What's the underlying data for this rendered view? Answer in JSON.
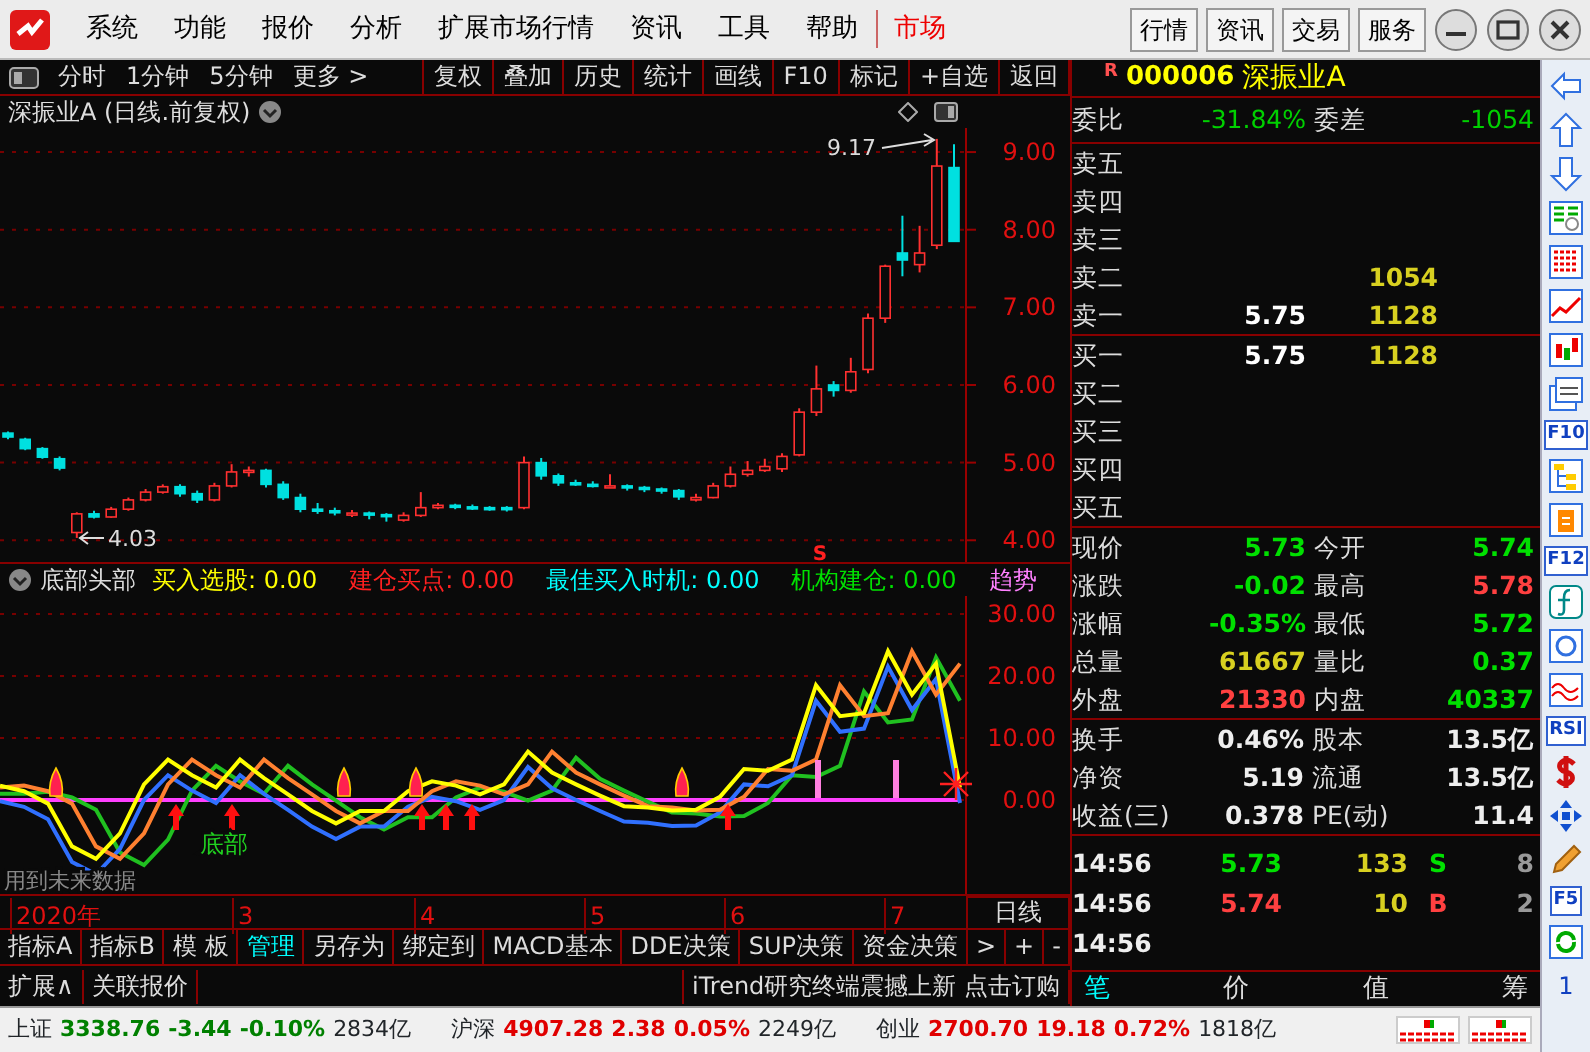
{
  "menu_bar": {
    "items": [
      {
        "label": "系统",
        "selected": false
      },
      {
        "label": "功能",
        "selected": false
      },
      {
        "label": "报价",
        "selected": false
      },
      {
        "label": "分析",
        "selected": false
      },
      {
        "label": "扩展市场行情",
        "selected": false
      },
      {
        "label": "资讯",
        "selected": false
      },
      {
        "label": "工具",
        "selected": false
      },
      {
        "label": "帮助",
        "selected": false
      },
      {
        "label": "市场",
        "selected": true
      }
    ],
    "buttons": [
      "行情",
      "资讯",
      "交易",
      "服务"
    ]
  },
  "toolbar": {
    "period_tabs": [
      "分时",
      "1分钟",
      "5分钟",
      "更多 >"
    ],
    "tools": [
      "复权",
      "叠加",
      "历史",
      "统计",
      "画线",
      "F10",
      "标记",
      "+自选",
      "返回"
    ]
  },
  "price_chart": {
    "title": "深振业A (日线.前复权)",
    "high_label": "9.17",
    "low_label": "4.03",
    "signal": "S",
    "chart_data": {
      "type": "candlestick",
      "grid": true,
      "ylim": [
        3.72,
        9.31
      ],
      "yticks": [
        {
          "value": 9,
          "label": "9.00"
        },
        {
          "value": 8,
          "label": "8.00"
        },
        {
          "value": 7,
          "label": "7.00"
        },
        {
          "value": 6,
          "label": "6.00"
        },
        {
          "value": 5,
          "label": "5.00"
        },
        {
          "value": 4,
          "label": "4.00"
        }
      ],
      "ohlc": [
        [
          5.38,
          5.4,
          5.3,
          5.33
        ],
        [
          5.3,
          5.32,
          5.16,
          5.18
        ],
        [
          5.18,
          5.2,
          5.05,
          5.07
        ],
        [
          5.05,
          5.08,
          4.9,
          4.93
        ],
        [
          4.1,
          4.36,
          4.03,
          4.34
        ],
        [
          4.34,
          4.38,
          4.28,
          4.3
        ],
        [
          4.3,
          4.43,
          4.29,
          4.4
        ],
        [
          4.4,
          4.55,
          4.38,
          4.52
        ],
        [
          4.52,
          4.66,
          4.5,
          4.62
        ],
        [
          4.62,
          4.72,
          4.6,
          4.69
        ],
        [
          4.69,
          4.72,
          4.56,
          4.6
        ],
        [
          4.6,
          4.64,
          4.48,
          4.52
        ],
        [
          4.52,
          4.74,
          4.5,
          4.7
        ],
        [
          4.7,
          4.98,
          4.68,
          4.88
        ],
        [
          4.88,
          4.95,
          4.82,
          4.9
        ],
        [
          4.9,
          4.92,
          4.68,
          4.72
        ],
        [
          4.72,
          4.76,
          4.52,
          4.55
        ],
        [
          4.55,
          4.6,
          4.36,
          4.4
        ],
        [
          4.4,
          4.48,
          4.34,
          4.38
        ],
        [
          4.38,
          4.42,
          4.32,
          4.36
        ],
        [
          4.33,
          4.39,
          4.3,
          4.35
        ],
        [
          4.35,
          4.37,
          4.27,
          4.33
        ],
        [
          4.33,
          4.35,
          4.24,
          4.31
        ],
        [
          4.26,
          4.36,
          4.24,
          4.32
        ],
        [
          4.32,
          4.62,
          4.3,
          4.42
        ],
        [
          4.42,
          4.48,
          4.4,
          4.45
        ],
        [
          4.45,
          4.47,
          4.4,
          4.43
        ],
        [
          4.43,
          4.46,
          4.39,
          4.42
        ],
        [
          4.42,
          4.44,
          4.38,
          4.41
        ],
        [
          4.42,
          4.44,
          4.37,
          4.4
        ],
        [
          4.42,
          5.08,
          4.4,
          5.0
        ],
        [
          5.0,
          5.06,
          4.78,
          4.83
        ],
        [
          4.83,
          4.86,
          4.7,
          4.74
        ],
        [
          4.74,
          4.78,
          4.7,
          4.72
        ],
        [
          4.72,
          4.76,
          4.68,
          4.71
        ],
        [
          4.7,
          4.85,
          4.68,
          4.7
        ],
        [
          4.7,
          4.72,
          4.64,
          4.68
        ],
        [
          4.68,
          4.7,
          4.62,
          4.66
        ],
        [
          4.66,
          4.68,
          4.6,
          4.64
        ],
        [
          4.64,
          4.66,
          4.52,
          4.56
        ],
        [
          4.52,
          4.6,
          4.5,
          4.55
        ],
        [
          4.55,
          4.74,
          4.54,
          4.7
        ],
        [
          4.7,
          4.95,
          4.68,
          4.85
        ],
        [
          4.85,
          5.02,
          4.82,
          4.9
        ],
        [
          4.9,
          5.05,
          4.88,
          4.95
        ],
        [
          4.92,
          5.12,
          4.88,
          5.08
        ],
        [
          5.1,
          5.7,
          5.08,
          5.65
        ],
        [
          5.65,
          6.25,
          5.6,
          5.95
        ],
        [
          6.0,
          6.05,
          5.85,
          5.93
        ],
        [
          5.93,
          6.35,
          5.9,
          6.17
        ],
        [
          6.2,
          6.92,
          6.15,
          6.86
        ],
        [
          6.86,
          7.55,
          6.8,
          7.53
        ],
        [
          7.7,
          8.18,
          7.4,
          7.61
        ],
        [
          7.55,
          8.05,
          7.45,
          7.7
        ],
        [
          7.8,
          9.17,
          7.75,
          8.82
        ],
        [
          8.8,
          9.1,
          7.85,
          7.85
        ]
      ]
    }
  },
  "indicator": {
    "name": "底部头部",
    "values": [
      {
        "label": "买入选股: 0.00",
        "color": "#ffff00"
      },
      {
        "label": "建仓买点: 0.00",
        "color": "#ff2020"
      },
      {
        "label": "最佳买入时机: 0.00",
        "color": "#00ffff"
      },
      {
        "label": "机构建仓: 0.00",
        "color": "#00e000"
      },
      {
        "label": "趋势",
        "color": "#ff80ff"
      }
    ],
    "chart_data": {
      "type": "line",
      "grid": true,
      "ylim": [
        -15.5,
        32.9
      ],
      "yticks": [
        {
          "value": 30,
          "label": "30.00"
        },
        {
          "value": 20,
          "label": "20.00"
        },
        {
          "value": 10,
          "label": "10.00"
        },
        {
          "value": 0,
          "label": "0.00"
        }
      ],
      "series": [
        {
          "color": "#ff40ff",
          "values": [
            0,
            0,
            0,
            0,
            0,
            0,
            0,
            0,
            0,
            0,
            0,
            0,
            0,
            0,
            0,
            0,
            0,
            0,
            0,
            0,
            0,
            0,
            0,
            0,
            0,
            0,
            0,
            0,
            0,
            0,
            0,
            0,
            0,
            0,
            0,
            0,
            0,
            0,
            0,
            0,
            0
          ]
        },
        {
          "color": "#20c020",
          "values": [
            1,
            1,
            1.3,
            0.4,
            -1.6,
            -8.5,
            -10.5,
            -6.4,
            1.5,
            5.5,
            3,
            1,
            5.5,
            2.5,
            -0.1,
            -2.8,
            -4.8,
            -2.8,
            -2.8,
            0.4,
            2,
            1.3,
            -0.1,
            1.5,
            6.8,
            3.4,
            1.5,
            -0.3,
            -2,
            -2.2,
            -2.7,
            -2.6,
            -0.5,
            4,
            3.7,
            5.5,
            17.5,
            12.5,
            13,
            23,
            16
          ]
        },
        {
          "color": "#3070ff",
          "values": [
            -0.2,
            -1.1,
            -3.1,
            -10,
            -12,
            -7.9,
            0,
            4,
            1.5,
            -0.5,
            4,
            1,
            -1.6,
            -4.3,
            -6.3,
            -4.3,
            -4.3,
            -1.1,
            0.5,
            -0.2,
            -1.6,
            0,
            5.3,
            1.9,
            0,
            -1.8,
            -3.5,
            -3.7,
            -4.2,
            -4.1,
            -2,
            2.5,
            2.2,
            4,
            16,
            11,
            11.5,
            21.5,
            14.5,
            19.5,
            -0.5
          ]
        },
        {
          "color": "#ff8030",
          "values": [
            2,
            2.3,
            1.4,
            -0.6,
            -7.5,
            -9.5,
            -5.4,
            2.5,
            6.5,
            4,
            2,
            6.5,
            3.5,
            0.9,
            -1.8,
            -3.8,
            -1.8,
            -1.8,
            1.4,
            3,
            2.3,
            0.9,
            2.5,
            7.8,
            4.4,
            2.5,
            0.7,
            -1,
            -1.2,
            -1.7,
            -1.6,
            0.5,
            5,
            4.7,
            6.5,
            18.5,
            13.5,
            14,
            24,
            17,
            22
          ]
        },
        {
          "color": "#ffff00",
          "values": [
            2.3,
            1.4,
            -0.6,
            -7.5,
            -9.5,
            -5.4,
            2.5,
            6.5,
            4,
            2,
            6.5,
            3.5,
            0.9,
            -1.8,
            -3.8,
            -1.8,
            -1.8,
            1.4,
            3,
            2.3,
            0.9,
            2.5,
            7.8,
            4.4,
            2.5,
            0.7,
            -1,
            -1.2,
            -1.7,
            -1.6,
            0.5,
            5,
            4.7,
            6.5,
            18.5,
            13.5,
            14,
            24,
            17,
            22,
            2
          ]
        }
      ]
    },
    "bottom_label": "底部",
    "warning": "用到未来数据"
  },
  "date_axis": {
    "labels": [
      "2020年",
      "3",
      "4",
      "5",
      "6",
      "7"
    ],
    "period": "日线"
  },
  "indicator_tabs": [
    {
      "label": "指标A",
      "selected": false
    },
    {
      "label": "指标B",
      "selected": false
    },
    {
      "label": "模 板",
      "selected": false
    },
    {
      "label": "管理",
      "selected": true
    },
    {
      "label": "另存为",
      "selected": false
    },
    {
      "label": "绑定到",
      "selected": false
    },
    {
      "label": "MACD基本",
      "selected": false
    },
    {
      "label": "DDE决策",
      "selected": false
    },
    {
      "label": "SUP决策",
      "selected": false
    },
    {
      "label": "资金决策",
      "selected": false
    }
  ],
  "tab_controls": {
    "more": ">",
    "add": "+",
    "remove": "-"
  },
  "extension_bar": {
    "items": [
      "扩展∧",
      "关联报价"
    ],
    "ticker": "iTrend研究终端震撼上新 点击订购"
  },
  "quote": {
    "flag": "R",
    "code": "000006",
    "name": "深振业A",
    "ratio": {
      "label": "委比",
      "value": "-31.84%",
      "label2": "委差",
      "value2": "-1054"
    },
    "asks": [
      {
        "label": "卖五"
      },
      {
        "label": "卖四"
      },
      {
        "label": "卖三"
      },
      {
        "label": "卖二",
        "volume": "1054"
      },
      {
        "label": "卖一",
        "price": "5.75",
        "volume": "1128"
      }
    ],
    "bids": [
      {
        "label": "买一",
        "price": "5.75",
        "volume": "1128"
      },
      {
        "label": "买二"
      },
      {
        "label": "买三"
      },
      {
        "label": "买四"
      },
      {
        "label": "买五"
      }
    ],
    "stats": [
      {
        "label": "现价",
        "value": "5.73",
        "color": "#00e000"
      },
      {
        "label": "今开",
        "value": "5.74",
        "color": "#00e000"
      },
      {
        "label": "涨跌",
        "value": "-0.02",
        "color": "#00e000"
      },
      {
        "label": "最高",
        "value": "5.78",
        "color": "#ff4040"
      },
      {
        "label": "涨幅",
        "value": "-0.35%",
        "color": "#00e000"
      },
      {
        "label": "最低",
        "value": "5.72",
        "color": "#00e000"
      },
      {
        "label": "总量",
        "value": "61667",
        "color": "#d8d020"
      },
      {
        "label": "量比",
        "value": "0.37",
        "color": "#00e000"
      },
      {
        "label": "外盘",
        "value": "21330",
        "color": "#ff4040"
      },
      {
        "label": "内盘",
        "value": "40337",
        "color": "#00e000"
      }
    ],
    "fundamentals": [
      {
        "label": "换手",
        "value": "0.46%",
        "label2": "股本",
        "value2": "13.5亿"
      },
      {
        "label": "净资",
        "value": "5.19",
        "label2": "流通",
        "value2": "13.5亿"
      },
      {
        "label": "收益(三)",
        "value": "0.378",
        "label2": "PE(动)",
        "value2": "11.4"
      }
    ],
    "trades": [
      {
        "time": "14:56",
        "price": "5.73",
        "volume": "133",
        "side": "S",
        "count": "8",
        "color": "#00e000"
      },
      {
        "time": "14:56",
        "price": "5.74",
        "volume": "10",
        "side": "B",
        "count": "2",
        "color": "#ff4040"
      },
      {
        "time": "14:56"
      }
    ],
    "detail_tabs": [
      {
        "label": "笔",
        "selected": true
      },
      {
        "label": "价",
        "selected": false
      },
      {
        "label": "值",
        "selected": false
      },
      {
        "label": "筹",
        "selected": false
      }
    ]
  },
  "side_toolbar": {
    "f10": "F10",
    "f12": "F12",
    "rsi": "RSI",
    "f5": "F5",
    "page": "1"
  },
  "status_bar": {
    "indices": [
      {
        "name": "上证",
        "value": "3338.76",
        "change": "-3.44",
        "percent": "-0.10%",
        "amount": "2834亿",
        "color": "#008000"
      },
      {
        "name": "沪深",
        "value": "4907.28",
        "change": "2.38",
        "percent": "0.05%",
        "amount": "2249亿",
        "color": "#e00000"
      },
      {
        "name": "创业",
        "value": "2700.70",
        "change": "19.18",
        "percent": "0.72%",
        "amount": "1818亿",
        "color": "#e00000"
      }
    ]
  }
}
